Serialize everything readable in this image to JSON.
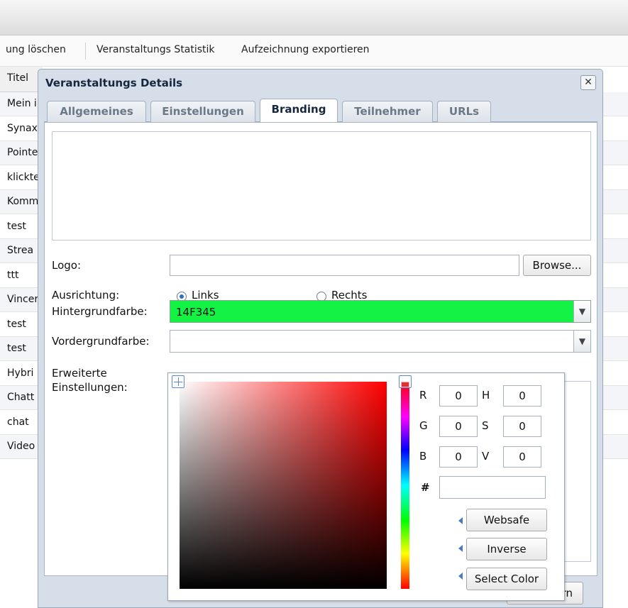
{
  "toolbar": {
    "items": [
      "ung löschen",
      "Veranstaltungs Statistik",
      "Aufzeichnung exportieren"
    ]
  },
  "grid": {
    "header": "Titel",
    "rows": [
      "Mein i",
      "Synax",
      "Pointe",
      "klickte",
      "Komm",
      "test",
      "Strea",
      "ttt",
      "Vincer",
      "test",
      "test",
      "Hybri",
      "Chatt",
      "chat",
      "Video"
    ]
  },
  "dialog": {
    "title": "Veranstaltungs Details",
    "close_icon": "close-icon",
    "tabs": [
      {
        "label": "Allgemeines",
        "active": false
      },
      {
        "label": "Einstellungen",
        "active": false
      },
      {
        "label": "Branding",
        "active": true
      },
      {
        "label": "Teilnehmer",
        "active": false
      },
      {
        "label": "URLs",
        "active": false
      }
    ],
    "form": {
      "logo_label": "Logo:",
      "logo_value": "",
      "browse_label": "Browse...",
      "alignment_label": "Ausrichtung:",
      "alignment_options": [
        {
          "label": "Links",
          "checked": true
        },
        {
          "label": "Rechts",
          "checked": false
        }
      ],
      "background_label": "Hintergrundfarbe:",
      "background_value": "14F345",
      "background_color": "#14F345",
      "foreground_label": "Vordergrundfarbe:",
      "foreground_value": "",
      "advanced_label_line1": "Erweiterte",
      "advanced_label_line2": "Einstellungen:",
      "combo_arrow_icon": "chevron-down-icon"
    },
    "footer_button_partial": "rn"
  },
  "color_picker": {
    "fields": {
      "R": "0",
      "G": "0",
      "B": "0",
      "H": "0",
      "S": "0",
      "V": "0"
    },
    "labels": {
      "R": "R",
      "G": "G",
      "B": "B",
      "H": "H",
      "S": "S",
      "V": "V",
      "hex": "#"
    },
    "hex_value": "",
    "buttons": [
      "Websafe",
      "Inverse",
      "Select Color"
    ],
    "hue_color": "#FF0000"
  }
}
